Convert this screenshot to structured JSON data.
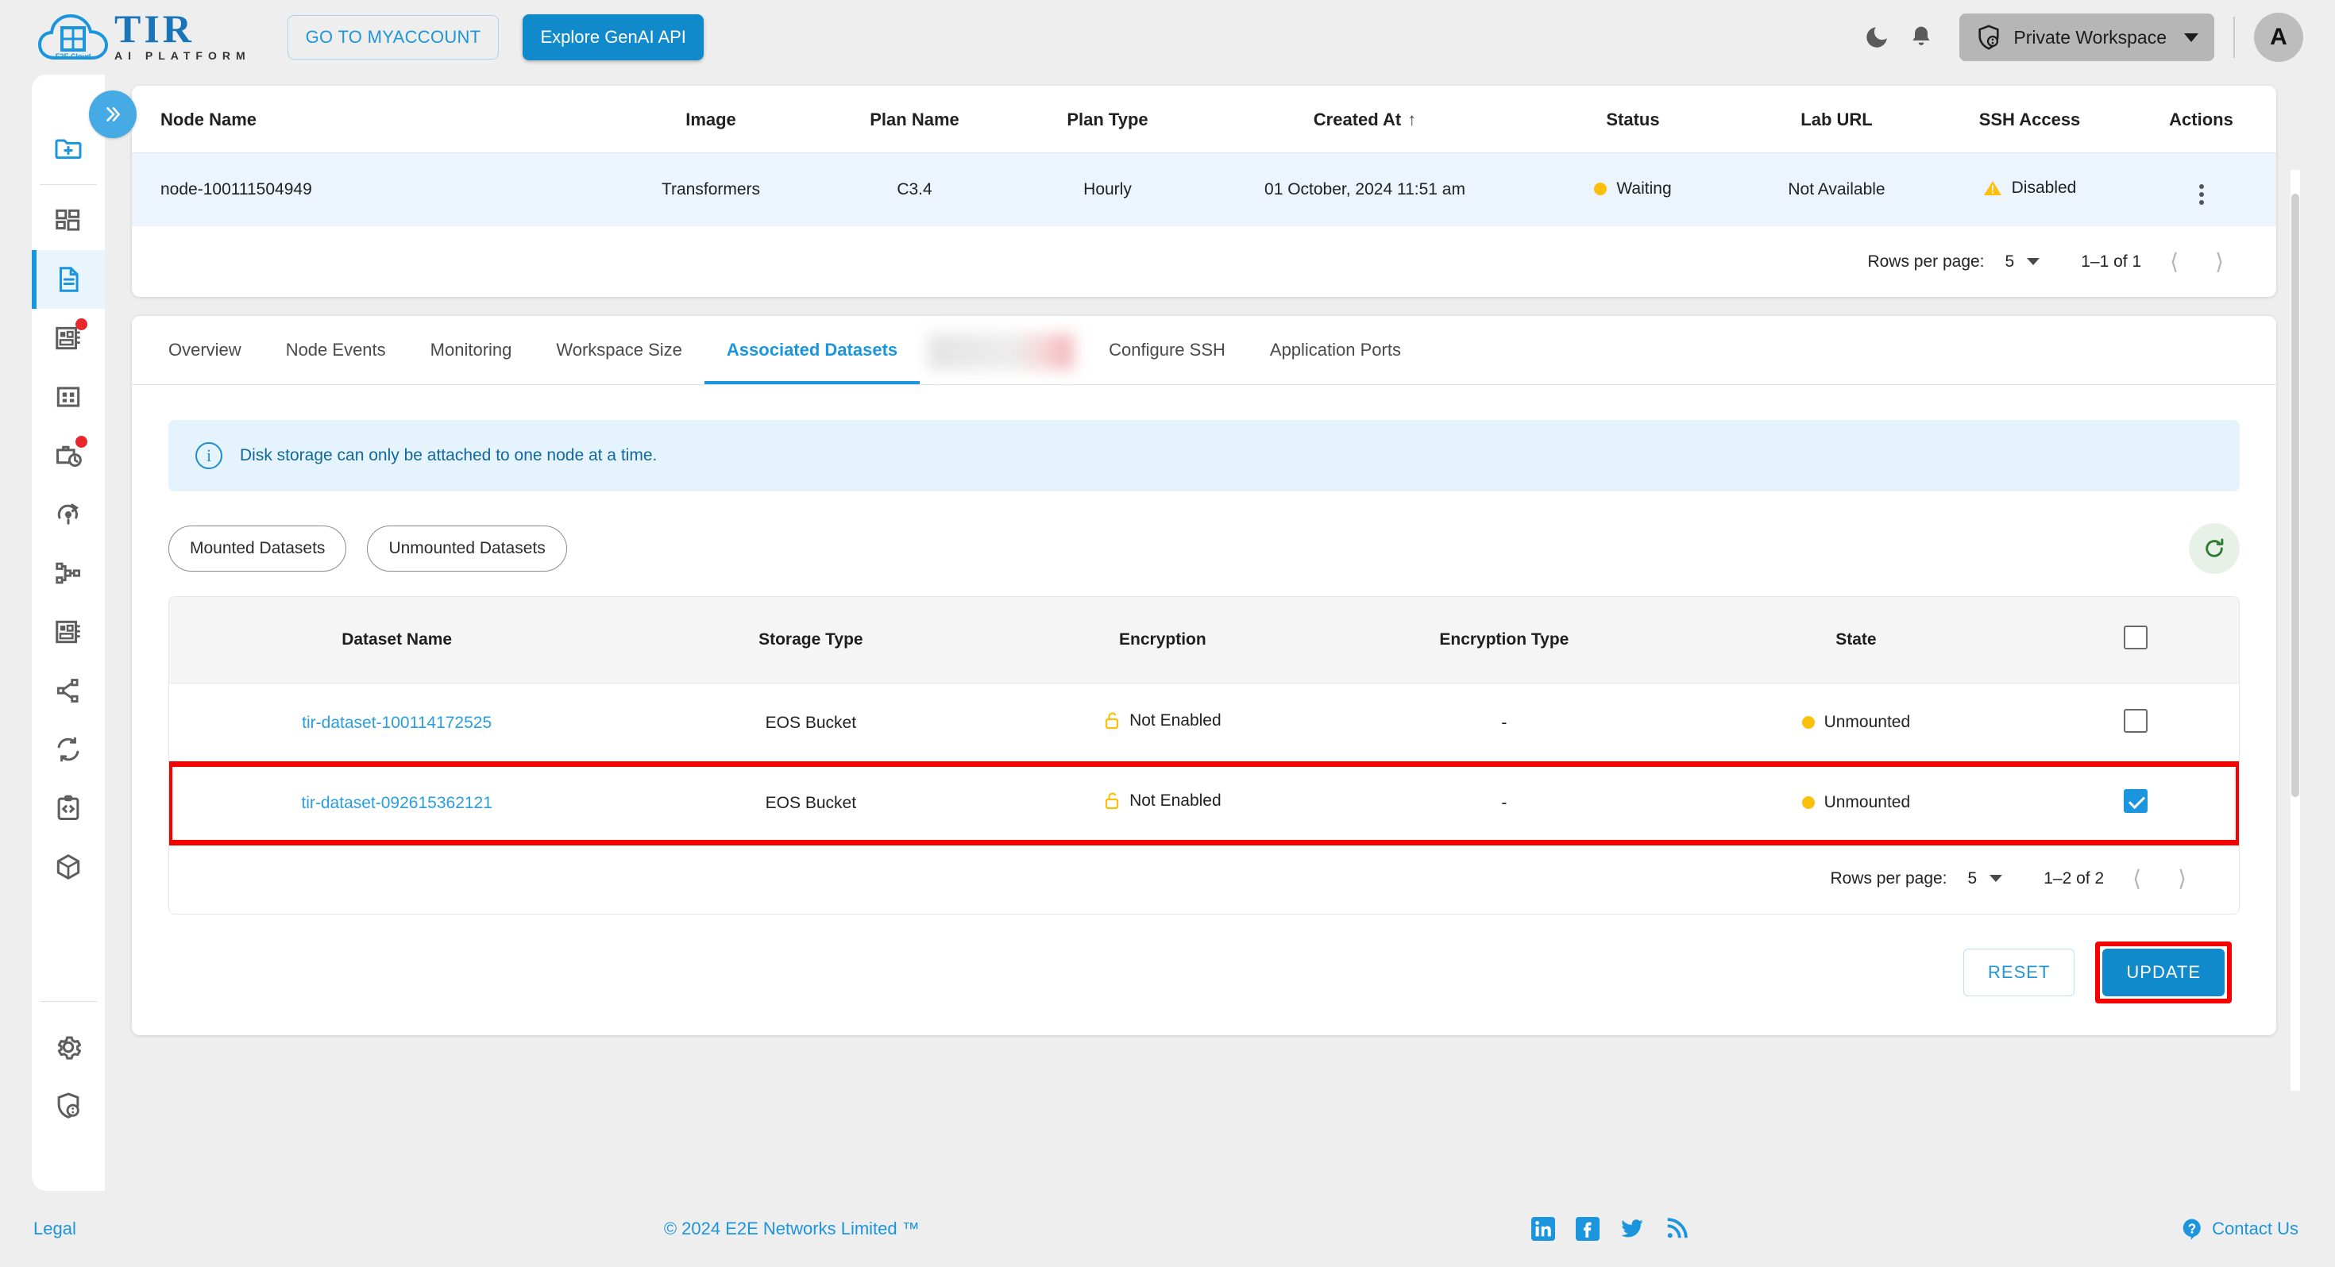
{
  "header": {
    "logo_primary": "TIR",
    "logo_sub": "AI PLATFORM",
    "logo_badge": "E2E Cloud",
    "myaccount_button": "GO TO MYACCOUNT",
    "genai_button": "Explore GenAI API",
    "workspace_label": "Private Workspace",
    "avatar_initial": "A",
    "dark_mode_icon": "moon-icon",
    "notification_icon": "bell-icon",
    "workspace_icon": "shield-user-icon"
  },
  "sidebar": {
    "collapse_icon": "chevron-double-right-icon",
    "items": [
      {
        "icon": "new-folder-icon",
        "active": false,
        "badge": false
      },
      {
        "icon": "dashboard-icon",
        "active": false,
        "badge": false
      },
      {
        "icon": "notebook-document-icon",
        "active": true,
        "badge": false
      },
      {
        "icon": "model-catalog-icon",
        "active": false,
        "badge": true
      },
      {
        "icon": "grid-apps-icon",
        "active": false,
        "badge": false
      },
      {
        "icon": "job-clock-icon",
        "active": false,
        "badge": true
      },
      {
        "icon": "pipeline-refresh-icon",
        "active": false,
        "badge": false
      },
      {
        "icon": "node-tree-icon",
        "active": false,
        "badge": false
      },
      {
        "icon": "catalog-book-icon",
        "active": false,
        "badge": false
      },
      {
        "icon": "share-network-icon",
        "active": false,
        "badge": false
      },
      {
        "icon": "sync-icon",
        "active": false,
        "badge": false
      },
      {
        "icon": "code-clipboard-icon",
        "active": false,
        "badge": false
      },
      {
        "icon": "package-cube-icon",
        "active": false,
        "badge": false
      }
    ],
    "bottom_items": [
      {
        "icon": "gear-settings-icon"
      },
      {
        "icon": "shield-security-icon"
      }
    ]
  },
  "node_table": {
    "columns": [
      "Node Name",
      "Image",
      "Plan Name",
      "Plan Type",
      "Created At",
      "Status",
      "Lab URL",
      "SSH Access",
      "Actions"
    ],
    "sort_column": "Created At",
    "sort_direction": "asc",
    "rows": [
      {
        "node_name": "node-100111504949",
        "image": "Transformers",
        "plan_name": "C3.4",
        "plan_type": "Hourly",
        "created_at": "01 October, 2024 11:51 am",
        "status": "Waiting",
        "lab_url": "Not Available",
        "ssh_access": "Disabled",
        "actions_icon": "kebab-menu-icon"
      }
    ],
    "pagination": {
      "rows_per_page_label": "Rows per page:",
      "rows_per_page_value": "5",
      "range": "1–1 of 1"
    }
  },
  "tabs": [
    {
      "label": "Overview",
      "active": false,
      "blurred": false
    },
    {
      "label": "Node Events",
      "active": false,
      "blurred": false
    },
    {
      "label": "Monitoring",
      "active": false,
      "blurred": false
    },
    {
      "label": "Workspace Size",
      "active": false,
      "blurred": false
    },
    {
      "label": "Associated Datasets",
      "active": true,
      "blurred": false
    },
    {
      "label": "",
      "active": false,
      "blurred": true
    },
    {
      "label": "Configure SSH",
      "active": false,
      "blurred": false
    },
    {
      "label": "Application Ports",
      "active": false,
      "blurred": false
    }
  ],
  "info_banner": {
    "icon": "info-circle-icon",
    "text": "Disk storage can only be attached to one node at a time."
  },
  "filters": {
    "chips": [
      "Mounted Datasets",
      "Unmounted Datasets"
    ],
    "refresh_icon": "refresh-icon"
  },
  "datasets_table": {
    "columns": [
      "Dataset Name",
      "Storage Type",
      "Encryption",
      "Encryption Type",
      "State"
    ],
    "select_all_checked": false,
    "rows": [
      {
        "name": "tir-dataset-100114172525",
        "storage_type": "EOS Bucket",
        "encryption": "Not Enabled",
        "encryption_type": "-",
        "state": "Unmounted",
        "checked": false,
        "highlighted": false
      },
      {
        "name": "tir-dataset-092615362121",
        "storage_type": "EOS Bucket",
        "encryption": "Not Enabled",
        "encryption_type": "-",
        "state": "Unmounted",
        "checked": true,
        "highlighted": true
      }
    ],
    "pagination": {
      "rows_per_page_label": "Rows per page:",
      "rows_per_page_value": "5",
      "range": "1–2 of 2"
    }
  },
  "actions": {
    "reset_label": "RESET",
    "update_label": "UPDATE"
  },
  "footer": {
    "legal": "Legal",
    "copyright": "© 2024 E2E Networks Limited ™",
    "contact": "Contact Us",
    "social": [
      "linkedin-icon",
      "facebook-icon",
      "twitter-icon",
      "rss-icon"
    ]
  },
  "colors": {
    "brand_blue": "#1a95de",
    "primary_button": "#118acb",
    "status_yellow": "#fcc00a",
    "highlight_red": "#f70000",
    "row_blue": "#ecf4fd"
  }
}
